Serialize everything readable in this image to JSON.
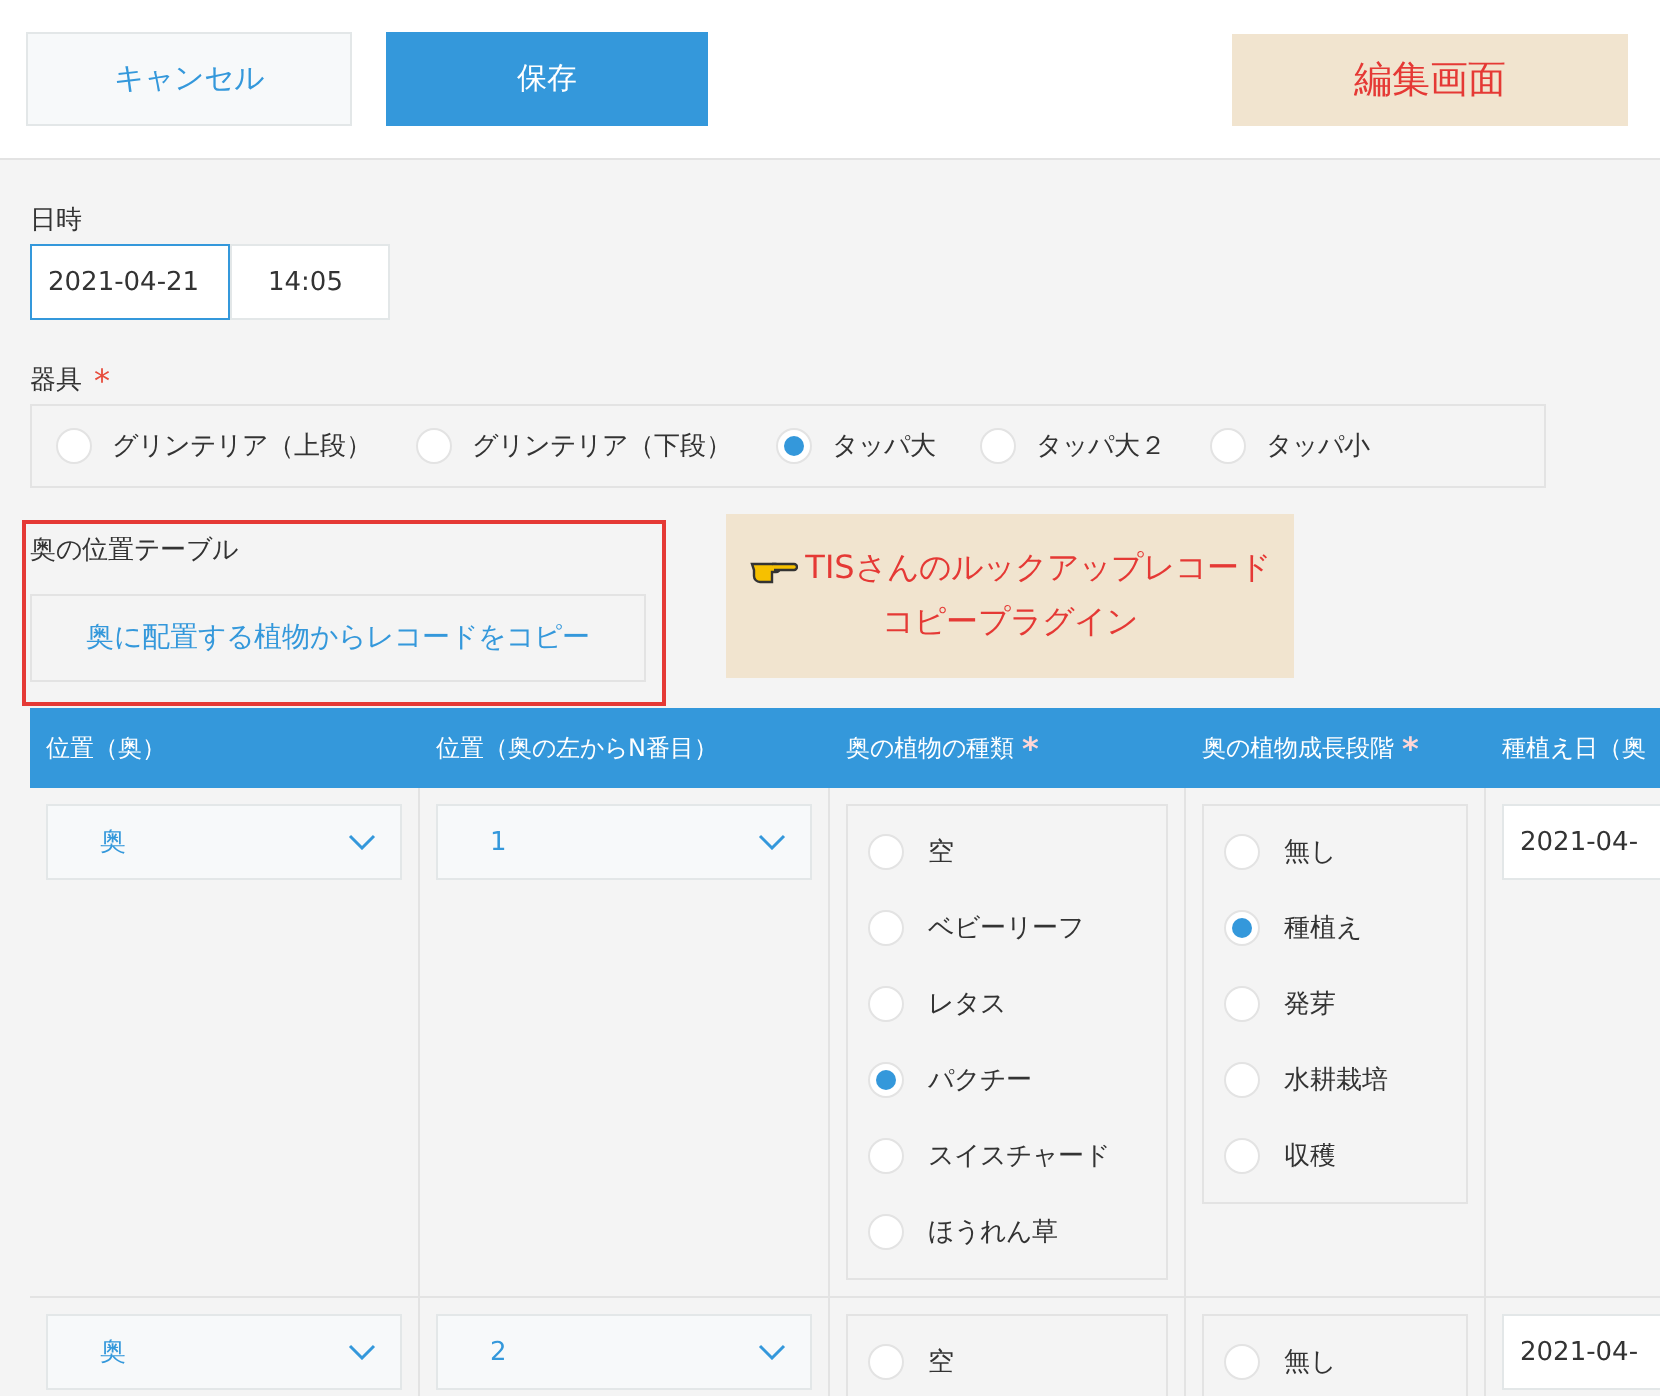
{
  "header": {
    "buttons": [
      {
        "label": "キャンセル",
        "kind": "secondary"
      },
      {
        "label": "保存",
        "kind": "primary"
      }
    ],
    "tag": "編集画面"
  },
  "datetime_field": {
    "label": "日時",
    "date": "2021-04-21",
    "time": "14:05",
    "date_focused": true
  },
  "equipment_field": {
    "label": "器具",
    "required_mark": "*",
    "options": [
      {
        "label": "グリンテリア（上段）",
        "selected": false
      },
      {
        "label": "グリンテリア（下段）",
        "selected": false
      },
      {
        "label": "タッパ大",
        "selected": true
      },
      {
        "label": "タッパ大２",
        "selected": false
      },
      {
        "label": "タッパ小",
        "selected": false
      }
    ]
  },
  "subtable_section": {
    "label": "奥の位置テーブル",
    "copy_button": "奥に配置する植物からレコードをコピー",
    "highlighted": true
  },
  "annotation": {
    "lines": [
      "TISさんのルックアップレコード",
      "コピープラグイン"
    ]
  },
  "table": {
    "columns": [
      {
        "label": "位置（奥）"
      },
      {
        "label": "位置（奥の左からN番目）"
      },
      {
        "label": "奥の植物の種類",
        "required_mark": "*"
      },
      {
        "label": "奥の植物成長段階",
        "required_mark": "*"
      },
      {
        "label": "種植え日（奥"
      }
    ],
    "rows": [
      {
        "position": "奥",
        "index": "1",
        "plant_options": [
          {
            "label": "空",
            "selected": false
          },
          {
            "label": "ベビーリーフ",
            "selected": false
          },
          {
            "label": "レタス",
            "selected": false
          },
          {
            "label": "パクチー",
            "selected": true
          },
          {
            "label": "スイスチャード",
            "selected": false
          },
          {
            "label": "ほうれん草",
            "selected": false
          }
        ],
        "stage_options": [
          {
            "label": "無し",
            "selected": false
          },
          {
            "label": "種植え",
            "selected": true
          },
          {
            "label": "発芽",
            "selected": false
          },
          {
            "label": "水耕栽培",
            "selected": false
          },
          {
            "label": "収穫",
            "selected": false
          }
        ],
        "planting_date": "2021-04-"
      },
      {
        "position": "奥",
        "index": "2",
        "plant_options": [
          {
            "label": "空",
            "selected": false
          }
        ],
        "stage_options": [
          {
            "label": "無し",
            "selected": false
          }
        ],
        "planting_date": "2021-04-"
      }
    ]
  }
}
